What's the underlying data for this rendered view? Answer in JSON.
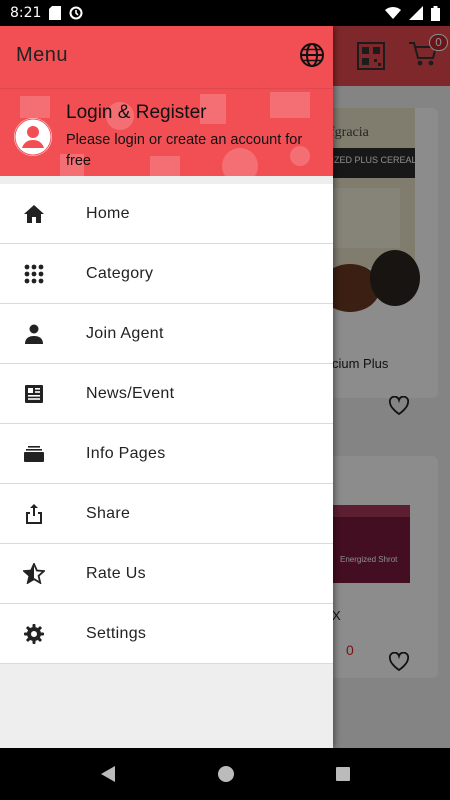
{
  "status_bar": {
    "time": "8:21"
  },
  "colors": {
    "brand_red": "#f24f55",
    "toolbar_red": "#e84a4f",
    "price_red": "#d8232a"
  },
  "app": {
    "cart_count": "0",
    "products": [
      {
        "name": "cium Plus",
        "image_brand": "fgracia",
        "image_text": "RGIZED PLUS CEREAL"
      },
      {
        "name": "X",
        "price": "0",
        "image_text": "Energized Shrot"
      }
    ]
  },
  "drawer": {
    "title": "Menu",
    "login_title": "Login & Register",
    "login_subtitle": "Please login or create an account for free",
    "items": [
      {
        "label": "Home",
        "icon": "home-icon"
      },
      {
        "label": "Category",
        "icon": "grid-icon"
      },
      {
        "label": "Join Agent",
        "icon": "person-icon"
      },
      {
        "label": "News/Event",
        "icon": "newspaper-icon"
      },
      {
        "label": "Info Pages",
        "icon": "layers-icon"
      },
      {
        "label": "Share",
        "icon": "share-icon"
      },
      {
        "label": "Rate Us",
        "icon": "star-icon"
      },
      {
        "label": "Settings",
        "icon": "gear-icon"
      }
    ]
  }
}
